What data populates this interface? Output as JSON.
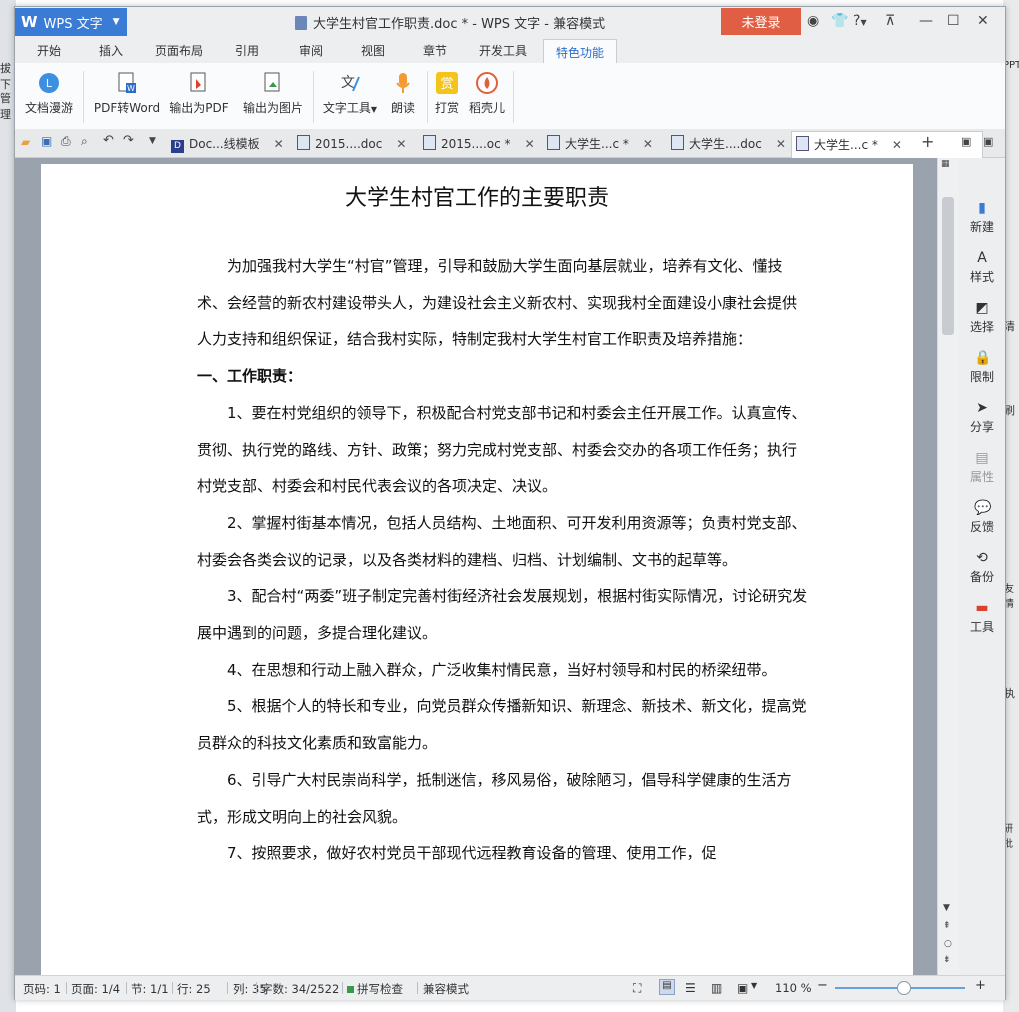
{
  "background": {
    "left_labels": [
      "拔下",
      "管理"
    ],
    "right_labels": [
      "PPT",
      "清",
      "刷",
      "友情",
      "执",
      "研批"
    ]
  },
  "titlebar": {
    "app_name": "WPS 文字",
    "title": "大学生村官工作职责.doc * - WPS 文字 - 兼容模式",
    "login_label": "未登录",
    "help_label": "?"
  },
  "ribbon_tabs": [
    "开始",
    "插入",
    "页面布局",
    "引用",
    "审阅",
    "视图",
    "章节",
    "开发工具",
    "特色功能"
  ],
  "active_tab": "特色功能",
  "ribbon_buttons": [
    {
      "label": "文档漫游",
      "icon": "cloud-icon"
    },
    {
      "label": "PDF转Word",
      "icon": "pdf-to-word-icon"
    },
    {
      "label": "输出为PDF",
      "icon": "export-pdf-icon"
    },
    {
      "label": "输出为图片",
      "icon": "export-image-icon"
    },
    {
      "label": "文字工具",
      "icon": "text-tools-icon"
    },
    {
      "label": "朗读",
      "icon": "microphone-icon"
    },
    {
      "label": "打赏",
      "icon": "reward-icon"
    },
    {
      "label": "稻壳儿",
      "icon": "docer-icon"
    }
  ],
  "doc_tabs": [
    {
      "label": "Doc...线模板"
    },
    {
      "label": "2015....doc"
    },
    {
      "label": "2015....oc *"
    },
    {
      "label": "大学生...c *"
    },
    {
      "label": "大学生....doc"
    },
    {
      "label": "大学生...c *"
    }
  ],
  "document": {
    "title": "大学生村官工作的主要职责",
    "paragraphs": [
      "为加强我村大学生“村官”管理，引导和鼓励大学生面向基层就业，培养有文化、懂技术、会经营的新农村建设带头人，为建设社会主义新农村、实现我村全面建设小康社会提供人力支持和组织保证，结合我村实际，特制定我村大学生村官工作职责及培养措施：",
      "一、工作职责：",
      "1、要在村党组织的领导下，积极配合村党支部书记和村委会主任开展工作。认真宣传、贯彻、执行党的路线、方针、政策；努力完成村党支部、村委会交办的各项工作任务；执行村党支部、村委会和村民代表会议的各项决定、决议。",
      "2、掌握村街基本情况，包括人员结构、土地面积、可开发利用资源等；负责村党支部、村委会各类会议的记录，以及各类材料的建档、归档、计划编制、文书的起草等。",
      "3、配合村“两委”班子制定完善村街经济社会发展规划，根据村街实际情况，讨论研究发展中遇到的问题，多提合理化建议。",
      "4、在思想和行动上融入群众，广泛收集村情民意，当好村领导和村民的桥梁纽带。",
      "5、根据个人的特长和专业，向党员群众传播新知识、新理念、新技术、新文化，提高党员群众的科技文化素质和致富能力。",
      "6、引导广大村民崇尚科学，抵制迷信，移风易俗，破除陋习，倡导科学健康的生活方式，形成文明向上的社会风貌。",
      "7、按照要求，做好农村党员干部现代远程教育设备的管理、使用工作，促"
    ]
  },
  "right_panel": [
    "新建",
    "样式",
    "选择",
    "限制",
    "分享",
    "属性",
    "反馈",
    "备份",
    "工具"
  ],
  "status_bar": {
    "page_code": "页码: 1",
    "page": "页面: 1/4",
    "section": "节: 1/1",
    "row": "行: 25",
    "column": "列: 35",
    "word_count": "字数: 34/2522",
    "spell_check": "拼写检查",
    "compat_mode": "兼容模式",
    "zoom": "110 %"
  },
  "colors": {
    "logo_blue": "#3a7bd5",
    "login_red": "#e05f44",
    "active_tab_text": "#2b6cc8"
  }
}
